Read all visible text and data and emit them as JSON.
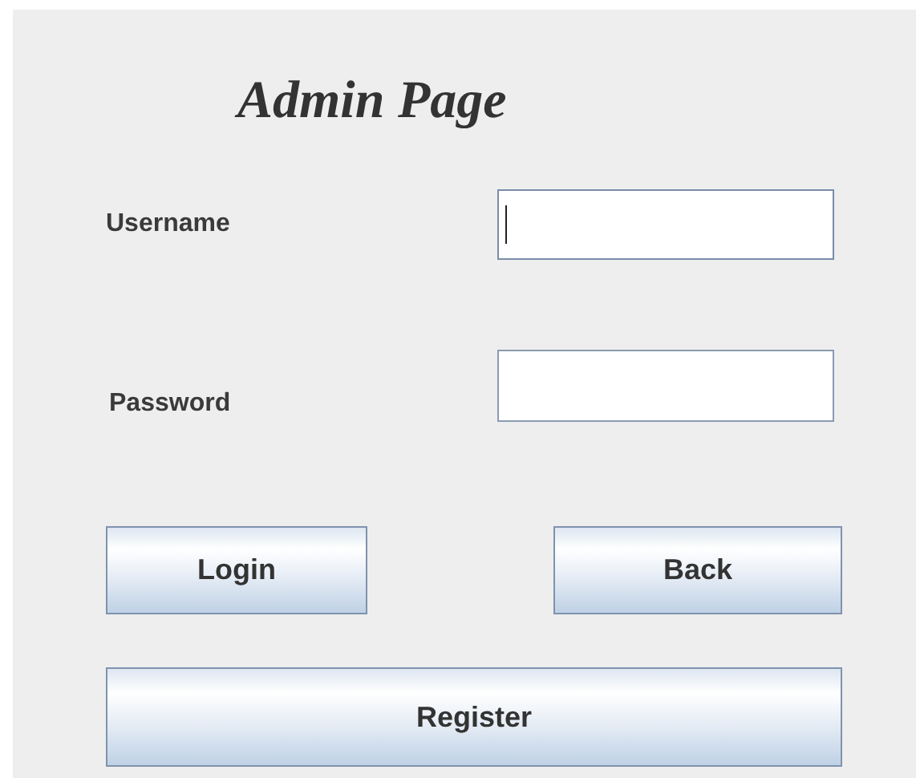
{
  "title": "Admin Page",
  "fields": [
    {
      "label": "Username",
      "focused": true
    },
    {
      "label": "Password",
      "focused": false
    }
  ],
  "buttons": [
    {
      "label": "Login"
    },
    {
      "label": "Back"
    },
    {
      "label": "Register"
    }
  ]
}
